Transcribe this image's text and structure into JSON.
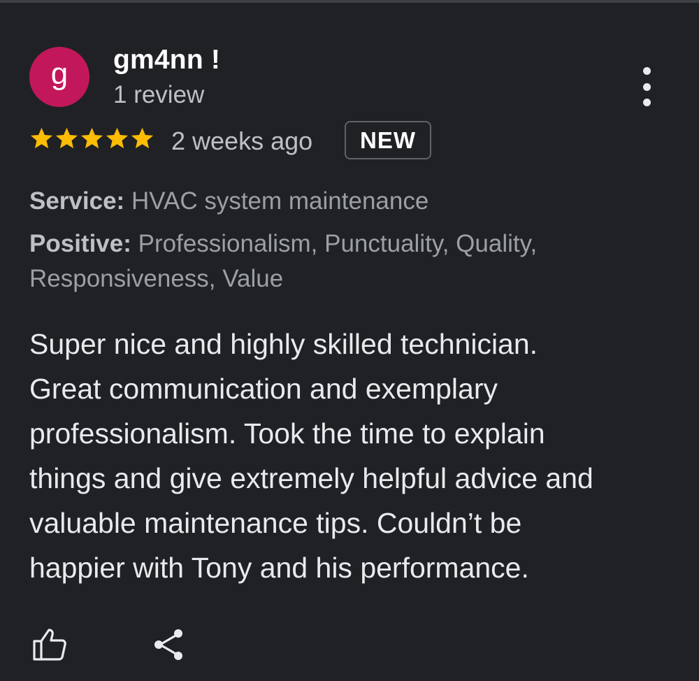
{
  "reviewer": {
    "avatar_letter": "g",
    "avatar_color": "#c2185b",
    "name": "gm4nn !",
    "review_count": "1 review"
  },
  "rating": {
    "stars": 5,
    "star_color": "#fbbc04",
    "time_ago": "2 weeks ago",
    "badge": "NEW"
  },
  "attributes": {
    "service_label": "Service:",
    "service_value": "HVAC system maintenance",
    "positive_label": "Positive:",
    "positive_value_line1": "Professionalism, Punctuality, Quality,",
    "positive_value_line2": "Responsiveness, Value"
  },
  "review": {
    "lines": [
      "Super nice and highly skilled technician.",
      "Great communication and exemplary",
      "professionalism. Took the time to explain",
      "things and give extremely helpful advice and",
      "valuable maintenance tips. Couldn’t be",
      "happier with Tony and his performance."
    ]
  },
  "actions": {
    "like_icon": "thumbs-up-icon",
    "share_icon": "share-icon",
    "more_icon": "more-vert-icon"
  }
}
